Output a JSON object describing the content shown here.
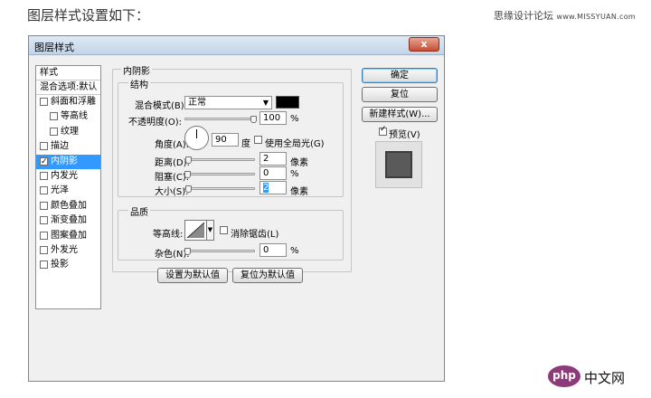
{
  "page": {
    "heading": "图层样式设置如下：",
    "credit_text": "思缘设计论坛",
    "credit_url": "www.MISSYUAN.com"
  },
  "dialog": {
    "title": "图层样式",
    "close_glyph": "x",
    "style_list": {
      "header": "样式",
      "blend_options": "混合选项:默认",
      "items": [
        {
          "label": "斜面和浮雕",
          "checked": false,
          "indent": 0
        },
        {
          "label": "等高线",
          "checked": false,
          "indent": 1
        },
        {
          "label": "纹理",
          "checked": false,
          "indent": 1
        },
        {
          "label": "描边",
          "checked": false,
          "indent": 0
        },
        {
          "label": "内阴影",
          "checked": true,
          "indent": 0,
          "selected": true
        },
        {
          "label": "内发光",
          "checked": false,
          "indent": 0
        },
        {
          "label": "光泽",
          "checked": false,
          "indent": 0
        },
        {
          "label": "颜色叠加",
          "checked": false,
          "indent": 0
        },
        {
          "label": "渐变叠加",
          "checked": false,
          "indent": 0
        },
        {
          "label": "图案叠加",
          "checked": false,
          "indent": 0
        },
        {
          "label": "外发光",
          "checked": false,
          "indent": 0
        },
        {
          "label": "投影",
          "checked": false,
          "indent": 0
        }
      ]
    },
    "inner_shadow": {
      "title": "内阴影",
      "structure": {
        "title": "结构",
        "blend_mode_label": "混合模式(B):",
        "blend_mode_value": "正常",
        "shadow_color": "#000000",
        "opacity_label": "不透明度(O):",
        "opacity_value": "100",
        "opacity_unit": "%",
        "angle_label": "角度(A):",
        "angle_value": "90",
        "angle_unit": "度",
        "global_light_label": "使用全局光(G)",
        "global_light_checked": false,
        "distance_label": "距离(D):",
        "distance_value": "2",
        "distance_unit": "像素",
        "choke_label": "阻塞(C):",
        "choke_value": "0",
        "choke_unit": "%",
        "size_label": "大小(S):",
        "size_value": "2",
        "size_unit": "像素"
      },
      "quality": {
        "title": "品质",
        "contour_label": "等高线:",
        "anti_alias_label": "消除锯齿(L)",
        "anti_alias_checked": false,
        "noise_label": "杂色(N):",
        "noise_value": "0",
        "noise_unit": "%"
      },
      "set_default_button": "设置为默认值",
      "reset_default_button": "复位为默认值"
    },
    "buttons": {
      "ok": "确定",
      "reset": "复位",
      "new_style": "新建样式(W)..."
    },
    "preview_label": "预览(V)",
    "preview_checked": true
  },
  "watermark": {
    "php": "php",
    "site": "中文网"
  }
}
